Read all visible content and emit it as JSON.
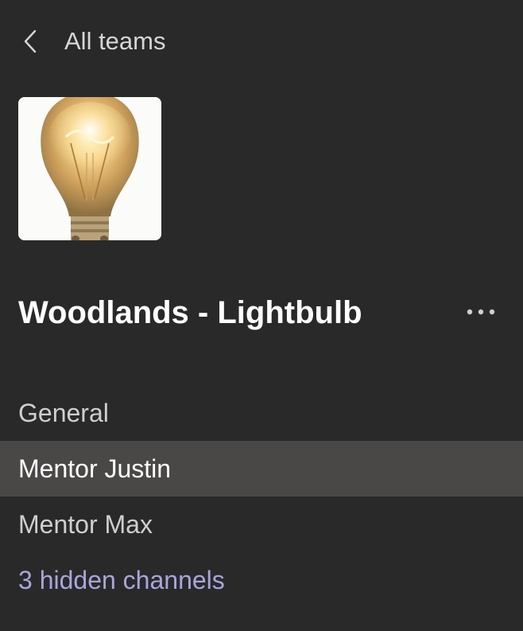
{
  "header": {
    "back_icon": "chevron-left-icon",
    "back_label": "All teams"
  },
  "team": {
    "avatar_image": "lightbulb",
    "title": "Woodlands - Lightbulb",
    "more_icon": "more-options-icon"
  },
  "channels": {
    "items": [
      {
        "label": "General",
        "selected": false
      },
      {
        "label": "Mentor Justin",
        "selected": true
      },
      {
        "label": "Mentor Max",
        "selected": false
      }
    ],
    "hidden_label": "3 hidden channels"
  },
  "colors": {
    "background": "#292929",
    "selected_background": "#494847",
    "hidden_link": "#a9a6dc"
  }
}
